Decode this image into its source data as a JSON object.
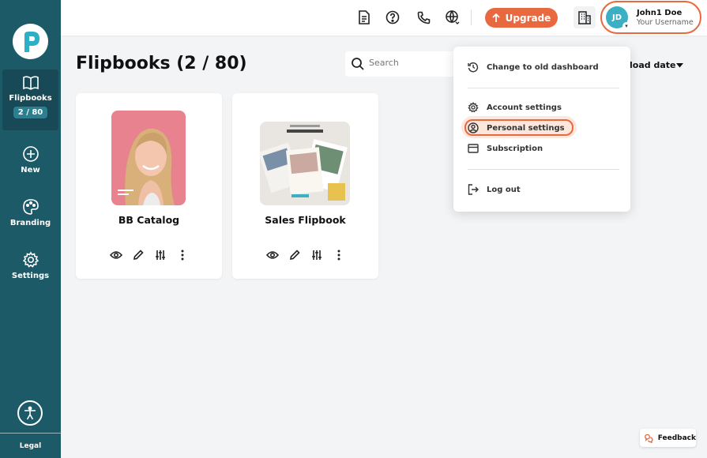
{
  "sidebar": {
    "flipbooks_label": "Flipbooks",
    "flipbooks_count": "2 / 80",
    "new_label": "New",
    "branding_label": "Branding",
    "settings_label": "Settings",
    "legal_label": "Legal"
  },
  "topbar": {
    "upgrade_label": "Upgrade",
    "avatar_initials": "JD",
    "user_name": "John1 Doe",
    "user_subtitle": "Your Username"
  },
  "main": {
    "title": "Flipbooks (2 / 80)",
    "search_placeholder": "Search",
    "sort_label": "load date"
  },
  "cards": [
    {
      "title": "BB Catalog"
    },
    {
      "title": "Sales Flipbook"
    }
  ],
  "dropdown": {
    "items": [
      {
        "label": "Change to old dashboard"
      },
      {
        "label": "Account settings"
      },
      {
        "label": "Personal settings"
      },
      {
        "label": "Subscription"
      },
      {
        "label": "Log out"
      }
    ]
  },
  "feedback_label": "Feedback",
  "colors": {
    "sidebar": "#1d5a68",
    "accent": "#e8683f",
    "avatar": "#3bafc3"
  }
}
